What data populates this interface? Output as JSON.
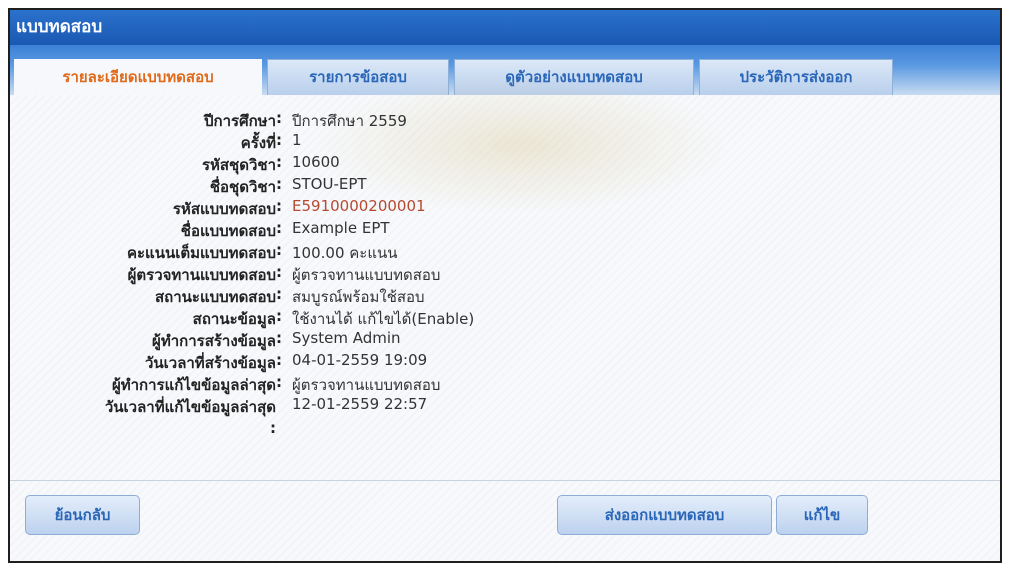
{
  "window": {
    "title": "แบบทดสอบ"
  },
  "tabs": [
    {
      "label": "รายละเอียดแบบทดสอบ",
      "active": true
    },
    {
      "label": "รายการข้อสอบ",
      "active": false
    },
    {
      "label": "ดูตัวอย่างแบบทดสอบ",
      "active": false
    },
    {
      "label": "ประวัติการส่งออก",
      "active": false
    }
  ],
  "details": [
    {
      "label": "ปีการศึกษา",
      "value": "ปีการศึกษา 2559"
    },
    {
      "label": "ครั้งที่",
      "value": "1"
    },
    {
      "label": "รหัสชุดวิชา",
      "value": "10600"
    },
    {
      "label": "ชื่อชุดวิชา",
      "value": "STOU-EPT"
    },
    {
      "label": "รหัสแบบทดสอบ",
      "value": "E5910000200001"
    },
    {
      "label": "ชื่อแบบทดสอบ",
      "value": "Example EPT"
    },
    {
      "label": "คะแนนเต็มแบบทดสอบ",
      "value": "100.00 คะแนน"
    },
    {
      "label": "ผู้ตรวจทานแบบทดสอบ",
      "value": "ผู้ตรวจทานแบบทดสอบ"
    },
    {
      "label": "สถานะแบบทดสอบ",
      "value": "สมบูรณ์พร้อมใช้สอบ"
    },
    {
      "label": "สถานะข้อมูล",
      "value": "ใช้งานได้ แก้ไขได้(Enable)"
    },
    {
      "label": "ผู้ทำการสร้างข้อมูล",
      "value": "System Admin"
    },
    {
      "label": "วันเวลาที่สร้างข้อมูล",
      "value": "04-01-2559 19:09"
    },
    {
      "label": "ผู้ทำการแก้ไขข้อมูลล่าสุด",
      "value": "ผู้ตรวจทานแบบทดสอบ"
    },
    {
      "label": "วันเวลาที่แก้ไขข้อมูลล่าสุด",
      "value": "12-01-2559 22:57"
    }
  ],
  "colon": ":",
  "buttons": {
    "back": "ย้อนกลับ",
    "export": "ส่งออกแบบทดสอบ",
    "edit": "แก้ไข"
  },
  "colors": {
    "accent": "#e06a1a",
    "value_accent": "#b54a2f",
    "title_bar": "#1a58b3"
  }
}
